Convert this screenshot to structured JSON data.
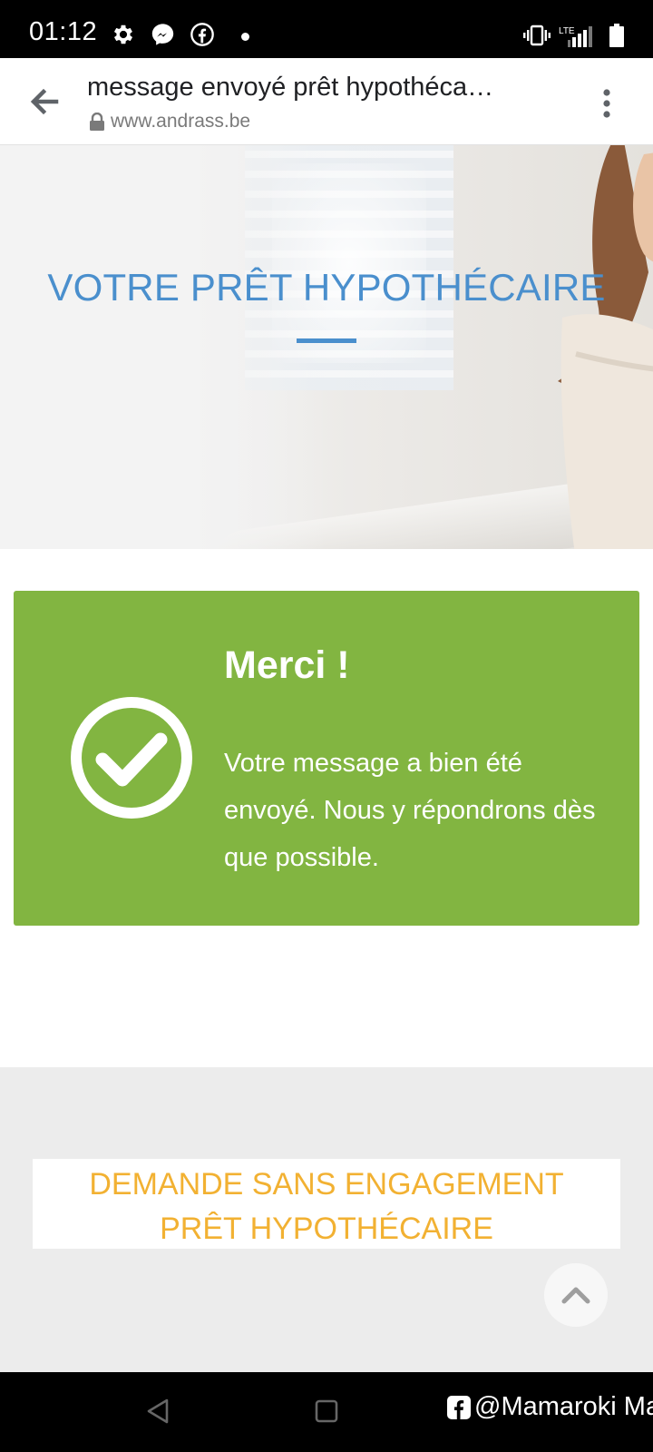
{
  "status_bar": {
    "time": "01:12",
    "icons": [
      "settings-icon",
      "messenger-icon",
      "facebook-icon",
      "notification-dot-icon",
      "vibrate-icon",
      "lte-signal-icon",
      "battery-icon"
    ],
    "network_label": "LTE"
  },
  "browser": {
    "page_title": "message envoyé prêt hypothéca…",
    "url": "www.andrass.be",
    "icons": [
      "back-arrow-icon",
      "lock-icon",
      "more-vert-icon"
    ]
  },
  "hero": {
    "title": "VOTRE PRÊT HYPOTHÉCAIRE"
  },
  "success": {
    "heading": "Merci !",
    "message": "Votre message a bien été envoyé. Nous y répondrons dès que possible.",
    "icon": "check-circle-icon"
  },
  "cta": {
    "line1": "DEMANDE SANS ENGAGEMENT",
    "line2": "PRÊT HYPOTHÉCAIRE"
  },
  "scroll_top": {
    "icon": "chevron-up-icon"
  },
  "nav_bar": {
    "icons": [
      "nav-back-icon",
      "nav-home-icon"
    ],
    "watermark": "@Mamaroki Ma"
  },
  "colors": {
    "accent_blue": "#4a8fcd",
    "success_green": "#82b541",
    "cta_orange": "#f2b132",
    "section_gray": "#ececec"
  }
}
